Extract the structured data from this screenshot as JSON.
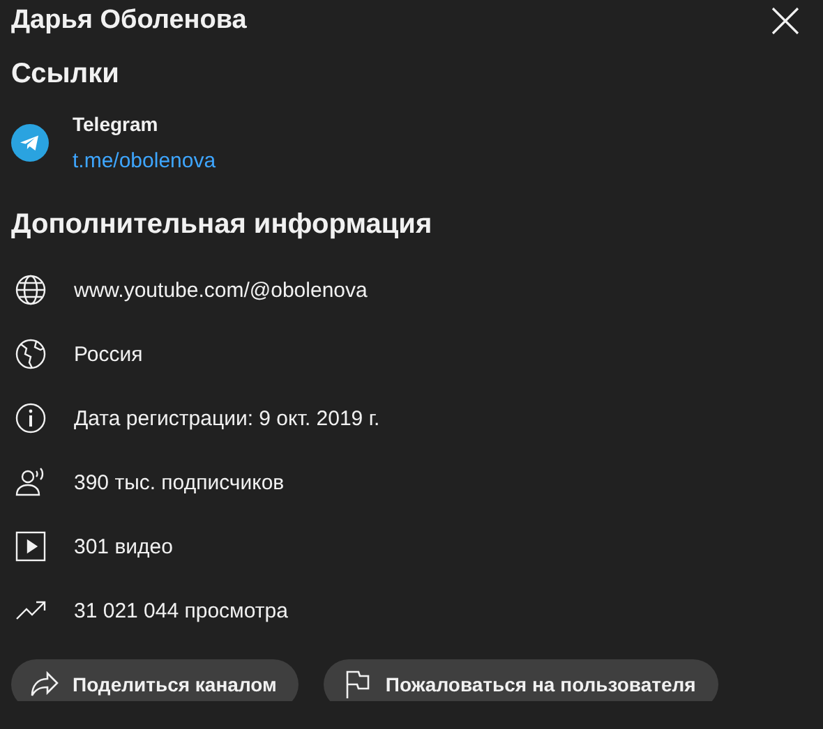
{
  "title": "Дарья Оболенова",
  "links_section": {
    "heading": "Ссылки",
    "links": [
      {
        "kind": "telegram",
        "name": "Telegram",
        "url": "t.me/obolenova"
      }
    ]
  },
  "info_section": {
    "heading": "Дополнительная информация",
    "rows": [
      {
        "kind": "website",
        "text": "www.youtube.com/@obolenova"
      },
      {
        "kind": "country",
        "text": "Россия"
      },
      {
        "kind": "joined",
        "text": "Дата регистрации: 9 окт. 2019 г."
      },
      {
        "kind": "subscribers",
        "text": "390 тыс. подписчиков"
      },
      {
        "kind": "videos",
        "text": "301 видео"
      },
      {
        "kind": "views",
        "text": "31 021 044 просмотра"
      }
    ]
  },
  "buttons": [
    {
      "kind": "share",
      "label": "Поделиться каналом"
    },
    {
      "kind": "report",
      "label": "Пожаловаться на пользователя"
    }
  ]
}
